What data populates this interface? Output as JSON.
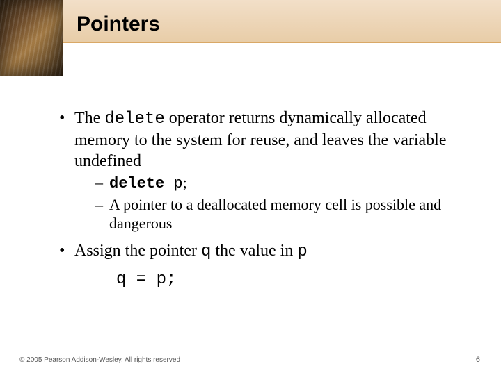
{
  "slide": {
    "title": "Pointers",
    "bullets": [
      {
        "pre": "The ",
        "code": "delete",
        "post": " operator returns dynamically allocated memory to the system for reuse, and leaves the variable undefined",
        "sub": [
          {
            "bold_code": "delete",
            "code_tail": " p",
            "post": ";"
          },
          {
            "text": "A pointer to a deallocated memory cell is possible and dangerous"
          }
        ]
      },
      {
        "pre": "Assign the pointer ",
        "code": "q",
        "mid": " the value in ",
        "code2": "p",
        "codeblock": "q = p;"
      }
    ],
    "footer": "© 2005 Pearson Addison-Wesley. All rights reserved",
    "page_number": "6"
  }
}
